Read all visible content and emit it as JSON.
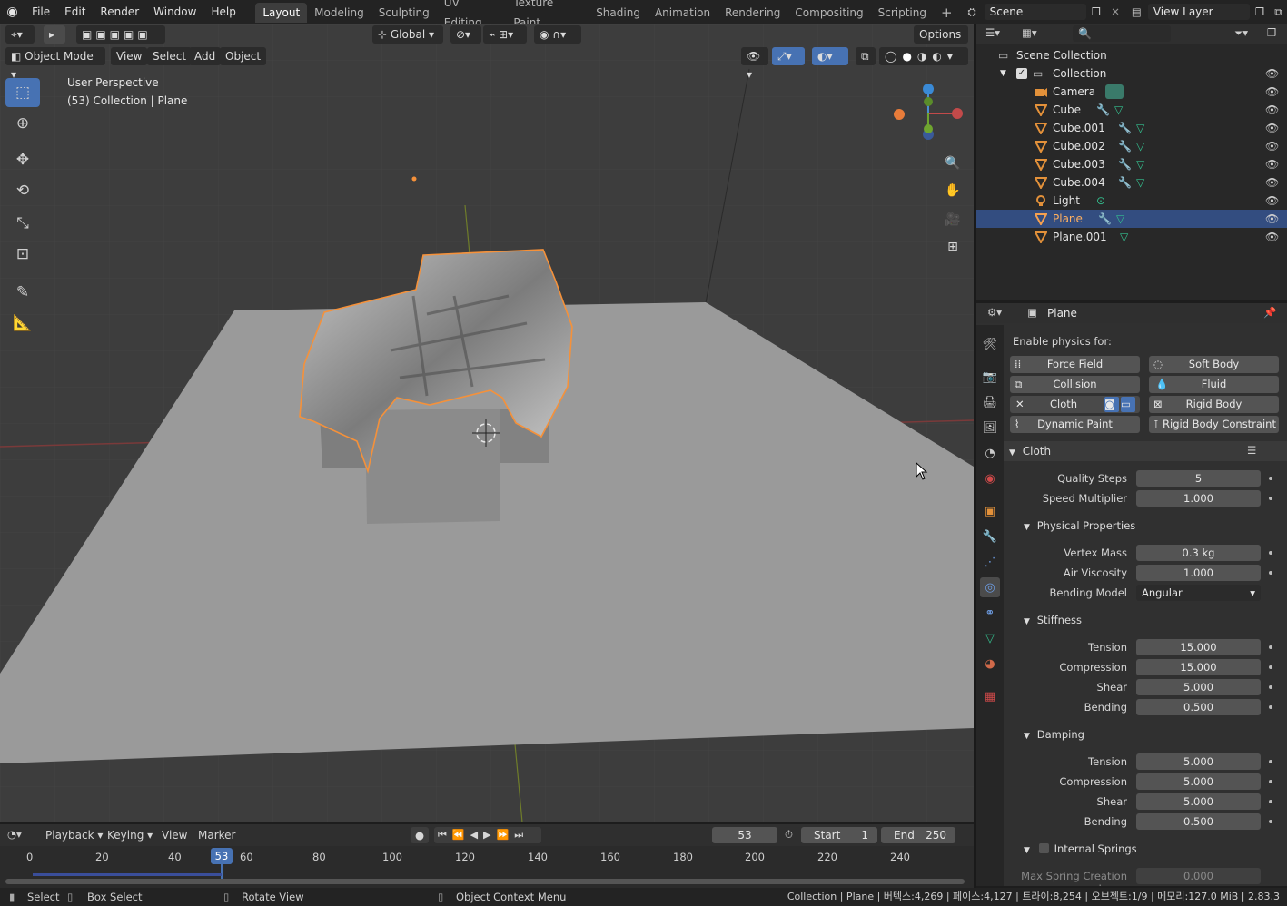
{
  "topbar": {
    "menus": [
      "File",
      "Edit",
      "Render",
      "Window",
      "Help"
    ],
    "workspaces": [
      "Layout",
      "Modeling",
      "Sculpting",
      "UV Editing",
      "Texture Paint",
      "Shading",
      "Animation",
      "Rendering",
      "Compositing",
      "Scripting"
    ],
    "add_tab": "+",
    "scene": "Scene",
    "view_layer": "View Layer"
  },
  "viewport_header": {
    "transform_orientation": "Global",
    "options": "Options",
    "mode": "Object Mode",
    "menus": [
      "View",
      "Select",
      "Add",
      "Object"
    ]
  },
  "viewport": {
    "perspective": "User Perspective",
    "context": "(53) Collection | Plane"
  },
  "outliner": {
    "search_placeholder": "",
    "scene_collection": "Scene Collection",
    "collection": "Collection",
    "items": [
      {
        "name": "Camera"
      },
      {
        "name": "Cube"
      },
      {
        "name": "Cube.001"
      },
      {
        "name": "Cube.002"
      },
      {
        "name": "Cube.003"
      },
      {
        "name": "Cube.004"
      },
      {
        "name": "Light"
      },
      {
        "name": "Plane"
      },
      {
        "name": "Plane.001"
      }
    ]
  },
  "properties": {
    "object_name": "Plane",
    "enable_physics_label": "Enable physics for:",
    "physics_buttons": {
      "force_field": "Force Field",
      "soft_body": "Soft Body",
      "collision": "Collision",
      "fluid": "Fluid",
      "cloth": "Cloth",
      "rigid_body": "Rigid Body",
      "dynamic_paint": "Dynamic Paint",
      "rigid_body_constraint": "Rigid Body Constraint"
    },
    "cloth_panel": "Cloth",
    "quality_steps_label": "Quality Steps",
    "quality_steps": "5",
    "speed_multiplier_label": "Speed Multiplier",
    "speed_multiplier": "1.000",
    "physical_properties": "Physical Properties",
    "vertex_mass_label": "Vertex Mass",
    "vertex_mass": "0.3 kg",
    "air_viscosity_label": "Air Viscosity",
    "air_viscosity": "1.000",
    "bending_model_label": "Bending Model",
    "bending_model": "Angular",
    "stiffness": "Stiffness",
    "stiffness_tension_label": "Tension",
    "stiffness_tension": "15.000",
    "stiffness_compression_label": "Compression",
    "stiffness_compression": "15.000",
    "stiffness_shear_label": "Shear",
    "stiffness_shear": "5.000",
    "stiffness_bending_label": "Bending",
    "stiffness_bending": "0.500",
    "damping": "Damping",
    "damping_tension_label": "Tension",
    "damping_tension": "5.000",
    "damping_compression_label": "Compression",
    "damping_compression": "5.000",
    "damping_shear_label": "Shear",
    "damping_shear": "5.000",
    "damping_bending_label": "Bending",
    "damping_bending": "0.500",
    "internal_springs": "Internal Springs",
    "max_spring_label": "Max Spring Creation Len...",
    "max_spring": "0.000"
  },
  "timeline": {
    "menus": [
      "Playback",
      "Keying",
      "View",
      "Marker"
    ],
    "current_frame": "53",
    "start_label": "Start",
    "start": "1",
    "end_label": "End",
    "end": "250",
    "ruler": [
      "0",
      "20",
      "40",
      "53",
      "60",
      "80",
      "100",
      "120",
      "140",
      "160",
      "180",
      "200",
      "220",
      "240"
    ]
  },
  "status": {
    "select": "Select",
    "box_select": "Box Select",
    "rotate_view": "Rotate View",
    "context_menu": "Object Context Menu",
    "stats": "Collection | Plane | 버텍스:4,269 | 페이스:4,127 | 트라이:8,254 | 오브젝트:1/9 | 메모리:127.0 MiB | 2.83.3"
  },
  "colors": {
    "accent_blue": "#4772b3",
    "selection_orange": "#f5913a",
    "selected_row": "#334d80"
  }
}
